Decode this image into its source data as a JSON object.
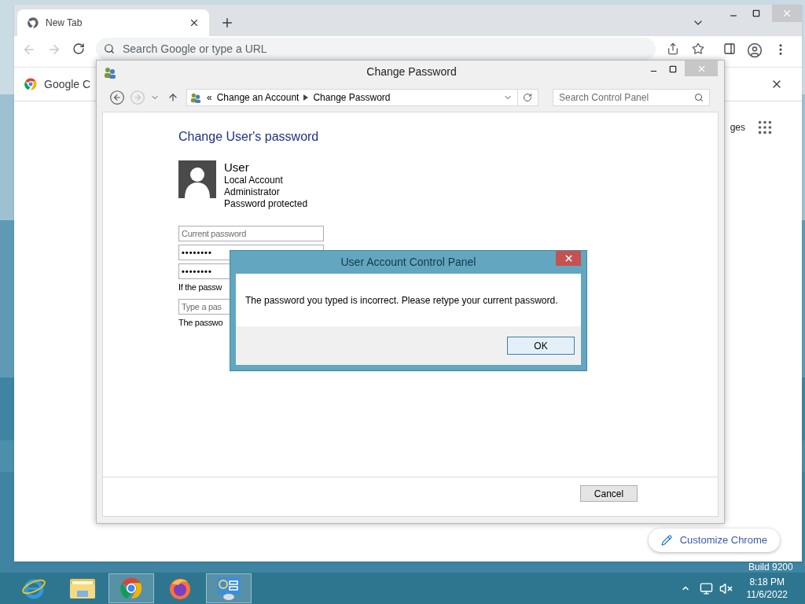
{
  "browser": {
    "tabs": [
      {
        "title": "New Tab",
        "selected": true
      }
    ],
    "address_placeholder": "Search Google or type a URL",
    "bookmarks": [
      {
        "label": "Google C"
      }
    ],
    "shortcut_text": "ges",
    "customize_button": "Customize Chrome"
  },
  "window": {
    "title": "Change Password",
    "overflow_mark": "«",
    "breadcrumb": [
      "Change an Account",
      "Change Password"
    ],
    "search_placeholder": "Search Control Panel",
    "heading": "Change User's password",
    "account": {
      "name": "User",
      "details": [
        "Local Account",
        "Administrator",
        "Password protected"
      ]
    },
    "form": [
      {
        "kind": "input",
        "placeholder": "Current password"
      },
      {
        "kind": "input",
        "value": "••••••••"
      },
      {
        "kind": "input",
        "value": "••••••••"
      },
      {
        "kind": "note",
        "text": "If the passw"
      },
      {
        "kind": "input",
        "placeholder": "Type a pas"
      },
      {
        "kind": "note",
        "text": "The passwo"
      }
    ],
    "buttons": [
      "Cancel"
    ]
  },
  "dialog": {
    "title": "User Account Control Panel",
    "message": "The password you typed is incorrect. Please retype your current password.",
    "buttons": [
      {
        "label": "OK",
        "focused": true
      }
    ]
  },
  "desktop": {
    "build_text": "Build 9200"
  },
  "taskbar": {
    "apps": [
      {
        "kind": "ie",
        "active": false
      },
      {
        "kind": "explorer",
        "active": false
      },
      {
        "kind": "chrome",
        "active": true
      },
      {
        "kind": "firefox",
        "active": false
      },
      {
        "kind": "control-panel",
        "active": true
      }
    ],
    "clock": {
      "time": "8:18 PM",
      "date": "11/6/2022"
    }
  }
}
